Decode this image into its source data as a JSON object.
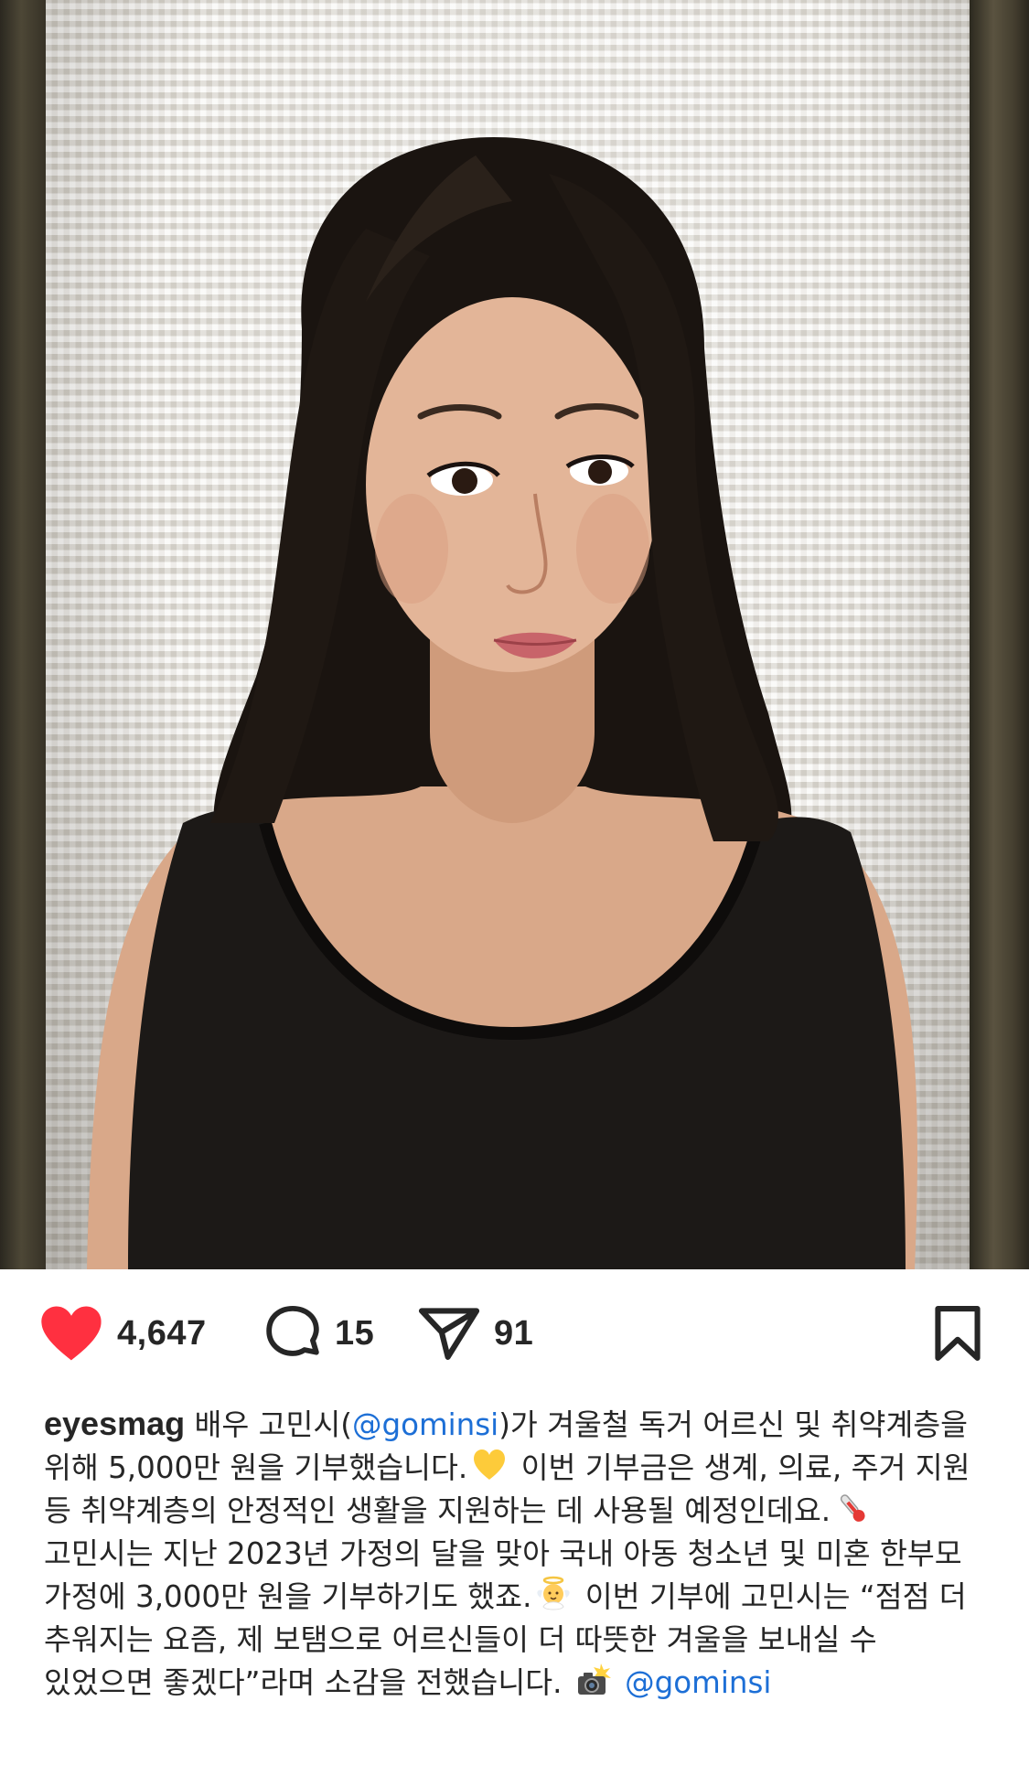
{
  "post": {
    "actions": {
      "likes": "4,647",
      "comments": "15",
      "shares": "91"
    },
    "caption": {
      "username": "eyesmag",
      "part1": " 배우 고민시(",
      "mention": "@gominsi",
      "part2": ")가 겨울철 독거 어르신 및 취약계층을 위해 5,000만 원을 기부했습니다.",
      "part3": " 이번 기부금은 생계, 의료, 주거 지원 등 취약계층의 안정적인 생활을 지원하는 데 사용될 예정인데요.",
      "part4": " 고민시는 지난 2023년 가정의 달을 맞아 국내 아동 청소년 및 미혼 한부모 가정에 3,000만 원을 기부하기도 했죠.",
      "part5": " 이번 기부에 고민시는 “점점 더 추워지는 요즘, 제 보탬으로 어르신들이 더 따뜻한 겨울을 보내실 수 있었으면 좋겠다”라며 소감을 전했습니다.",
      "credit_mention": "@gominsi"
    },
    "icons": {
      "like": "heart-filled-icon",
      "comment": "comment-bubble-icon",
      "share": "paper-plane-icon",
      "bookmark": "bookmark-icon",
      "emoji1": "yellow-heart-emoji",
      "emoji2": "thermometer-emoji",
      "emoji3": "baby-angel-emoji",
      "emoji4": "camera-flash-emoji"
    },
    "colors": {
      "like": "#ff3040",
      "text": "#262626",
      "mention": "#1d6fd6"
    }
  }
}
